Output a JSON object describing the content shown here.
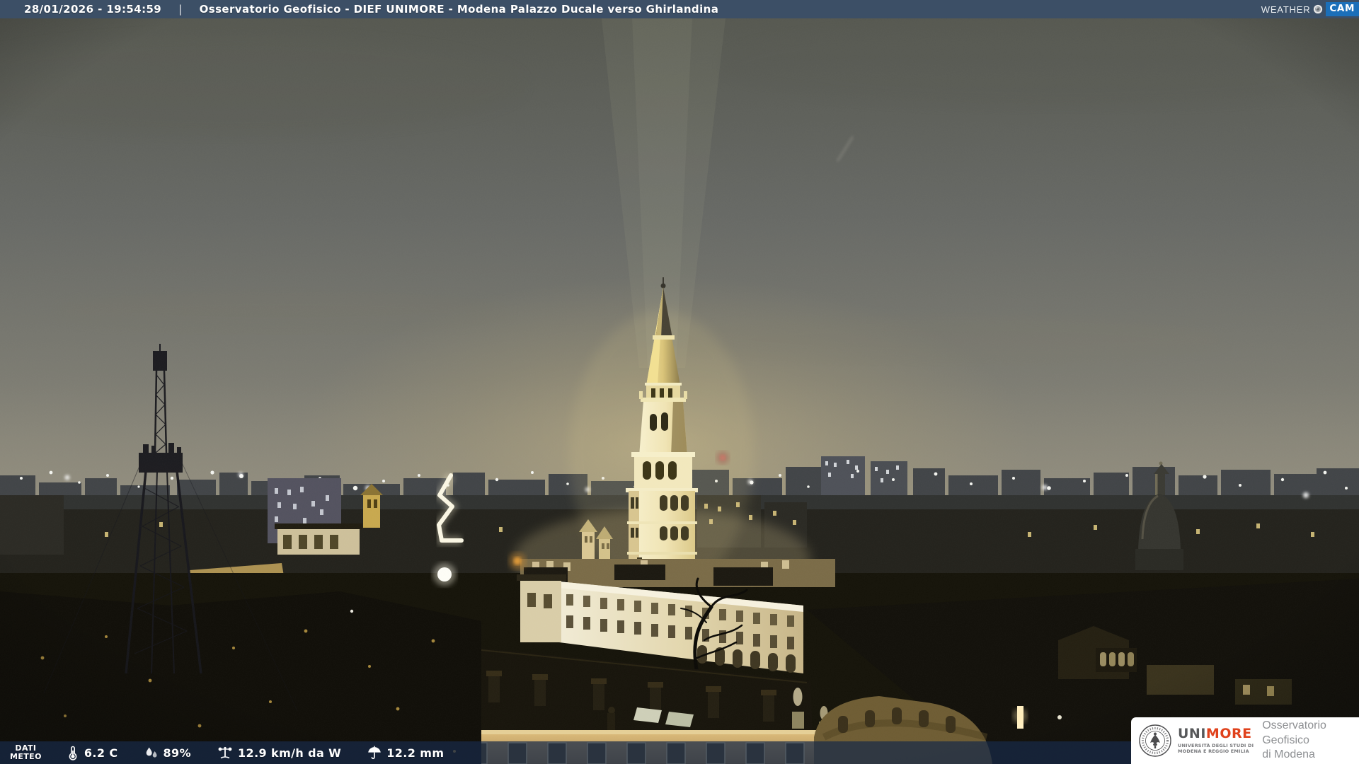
{
  "top_bar": {
    "datetime": "28/01/2026 - 19:54:59",
    "separator": "|",
    "title": "Osservatorio Geofisico - DIEF UNIMORE - Modena Palazzo Ducale verso Ghirlandina",
    "logo": {
      "weather": "WEATHER",
      "cam": "CAM"
    }
  },
  "bottom_bar": {
    "label_line1": "DATI",
    "label_line2": "METEO",
    "items": [
      {
        "icon": "thermometer-icon",
        "value": "6.2 C"
      },
      {
        "icon": "humidity-drops-icon",
        "value": "89%"
      },
      {
        "icon": "anemometer-icon",
        "value": "12.9 km/h da W"
      },
      {
        "icon": "rain-umbrella-icon",
        "value": "12.2 mm"
      }
    ]
  },
  "branding": {
    "acronym_uni": "UNI",
    "acronym_more": "MORE",
    "university_line1": "UNIVERSITÀ DEGLI STUDI DI",
    "university_line2": "MODENA E REGGIO EMILIA",
    "observatory_line1": "Osservatorio Geofisico",
    "observatory_line2": "di Modena"
  },
  "colors": {
    "top_bar_bg": "#3c4f66",
    "bottom_bar_bg": "rgba(24,42,72,0.72)",
    "cam_badge_bg": "#1b6fb9",
    "unimore_red": "#e0421c",
    "unimore_gray": "#57585a",
    "observatory_text": "#8e9093",
    "bar_text": "#ffffff"
  }
}
